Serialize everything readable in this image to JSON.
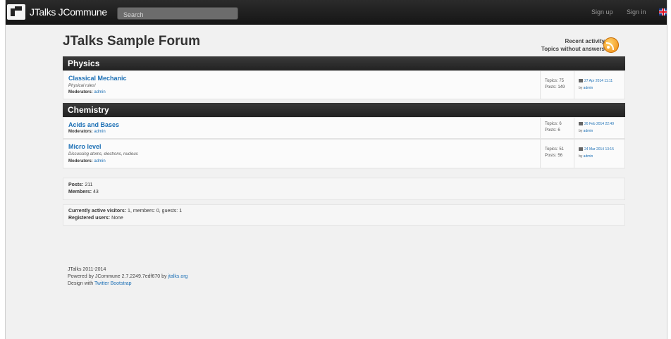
{
  "navbar": {
    "brand": "JTalks JCommune",
    "search_placeholder": "Search",
    "signup": "Sign up",
    "signin": "Sign in"
  },
  "page": {
    "title": "JTalks Sample Forum",
    "recent_activity": "Recent activity",
    "topics_without_answers": "Topics without answers"
  },
  "sections": [
    {
      "name": "Physics",
      "forums": [
        {
          "name": "Classical Mechanic",
          "description": "Physical rules!",
          "moderators_label": "Moderators:",
          "moderator": "admin",
          "topics": "Topics: 75",
          "posts": "Posts: 149",
          "last_date": "27 Apr 2014 11:11",
          "last_by": "by",
          "last_user": "admin"
        }
      ]
    },
    {
      "name": "Chemistry",
      "forums": [
        {
          "name": "Acids and Bases",
          "description": "",
          "moderators_label": "Moderators:",
          "moderator": "admin",
          "topics": "Topics: 6",
          "posts": "Posts: 6",
          "last_date": "26 Feb 2014 22:49",
          "last_by": "by",
          "last_user": "admin"
        },
        {
          "name": "Micro level",
          "description": "Discussing atoms, electrons, nucleus",
          "moderators_label": "Moderators:",
          "moderator": "admin",
          "topics": "Topics: 51",
          "posts": "Posts: 56",
          "last_date": "24 Mar 2014 13:15",
          "last_by": "by",
          "last_user": "admin"
        }
      ]
    }
  ],
  "stats": {
    "posts_label": "Posts:",
    "posts_value": "211",
    "members_label": "Members:",
    "members_value": "43"
  },
  "visitors": {
    "active_label": "Currently active visitors:",
    "active_value": "1, members: 0, guests: 1",
    "registered_label": "Registered users:",
    "registered_value": "None"
  },
  "footer": {
    "copyright": "JTalks 2011-2014",
    "powered_prefix": "Powered by JCommune 2.7.2249.7edf670 by",
    "powered_link": "jtalks.org",
    "design_prefix": "Design with",
    "design_link": "Twitter Bootstrap"
  },
  "icons": {
    "logo": "jtalks-logo-icon",
    "rss": "rss-icon",
    "flag": "uk-flag-icon",
    "calendar": "calendar-icon"
  }
}
